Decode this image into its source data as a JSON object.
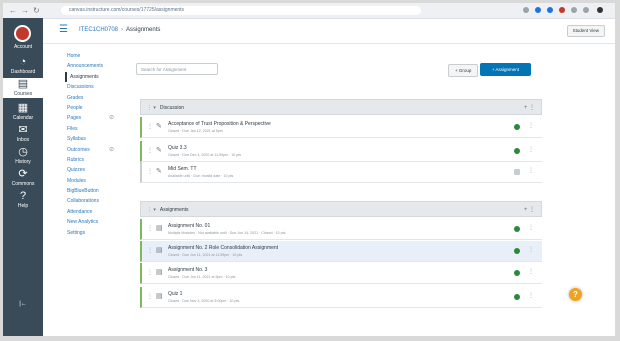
{
  "browser": {
    "url": "canvas.instructure.com/courses/17725/assignments",
    "nav_back": "←",
    "nav_forward": "→",
    "nav_reload": "↻"
  },
  "global_nav": {
    "items": [
      {
        "label": "Account",
        "icon": "account-icon"
      },
      {
        "label": "Dashboard",
        "icon": "dashboard-icon"
      },
      {
        "label": "Courses",
        "icon": "courses-icon"
      },
      {
        "label": "Calendar",
        "icon": "calendar-icon"
      },
      {
        "label": "Inbox",
        "icon": "inbox-icon"
      },
      {
        "label": "History",
        "icon": "history-icon"
      },
      {
        "label": "Commons",
        "icon": "commons-icon"
      },
      {
        "label": "Help",
        "icon": "help-icon"
      }
    ],
    "collapse": "|←"
  },
  "header": {
    "course": "ITEC1CH0708",
    "current": "Assignments",
    "separator": "›",
    "student_view": "Student View"
  },
  "course_nav": [
    {
      "label": "Home"
    },
    {
      "label": "Announcements"
    },
    {
      "label": "Assignments"
    },
    {
      "label": "Discussions"
    },
    {
      "label": "Grades"
    },
    {
      "label": "People"
    },
    {
      "label": "Pages"
    },
    {
      "label": "Files"
    },
    {
      "label": "Syllabus"
    },
    {
      "label": "Outcomes"
    },
    {
      "label": "Rubrics"
    },
    {
      "label": "Quizzes"
    },
    {
      "label": "Modules"
    },
    {
      "label": "BigBlueButton"
    },
    {
      "label": "Collaborations"
    },
    {
      "label": "Attendance"
    },
    {
      "label": "New Analytics"
    },
    {
      "label": "Settings"
    }
  ],
  "toolbar": {
    "search_placeholder": "Search for Assignment",
    "group_button": "+ Group",
    "add_button": "+ Assignment"
  },
  "groups": [
    {
      "name": "Discussion",
      "items": [
        {
          "title": "Acceptance of Trust Proposition & Perspective",
          "meta": "Closed · Due Jan 12, 2021 at 5pm",
          "published": true
        },
        {
          "title": "Quiz 3.3",
          "meta": "Closed · Due Dec 4, 2020 at 11:59pm · 10 pts",
          "published": true
        },
        {
          "title": "Mid Sem. TT",
          "meta": "Available until · Due: Invalid date · 10 pts",
          "published": false
        }
      ]
    },
    {
      "name": "Assignments",
      "items": [
        {
          "title": "Assignment No. 01",
          "meta": "Multiple Modules · Not available until · Due Jun 14, 2021 · Closed · 10 pts",
          "published": true
        },
        {
          "title": "Assignment No. 2 Role Consolidation Assignment",
          "meta": "Closed · Due Jun 11, 2021 at 11:59pm · 10 pts",
          "published": true
        },
        {
          "title": "Assignment No. 3",
          "meta": "Closed · Due Jun 11, 2021 at 5pm · 10 pts",
          "published": true
        },
        {
          "title": "Quiz 1",
          "meta": "Closed · Due Nov 3, 2020 at 5:00pm · 10 pts",
          "published": true
        }
      ]
    }
  ],
  "help_button": "?"
}
